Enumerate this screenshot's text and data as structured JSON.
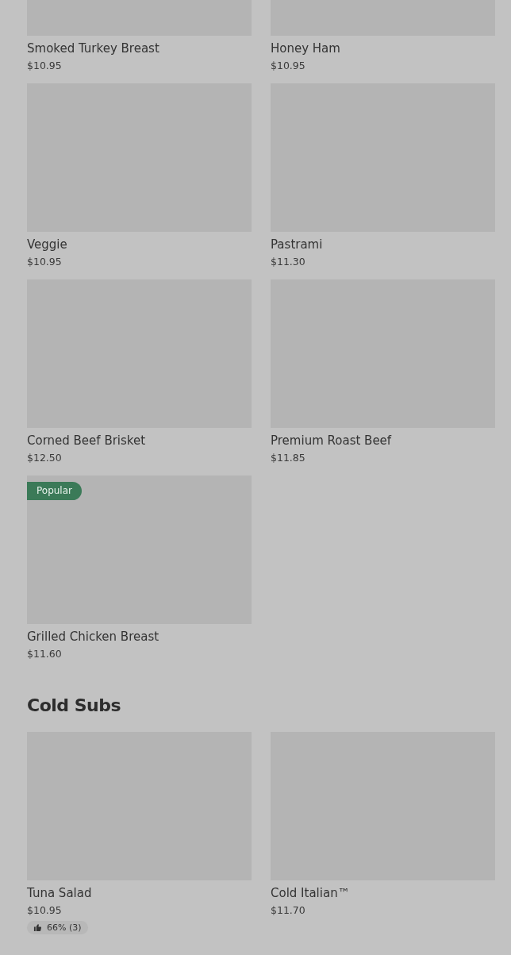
{
  "sections": [
    {
      "items": [
        {
          "name": "Smoked Turkey Breast",
          "price": "$10.95"
        },
        {
          "name": "Honey Ham",
          "price": "$10.95"
        },
        {
          "name": "Veggie",
          "price": "$10.95"
        },
        {
          "name": "Pastrami",
          "price": "$11.30"
        },
        {
          "name": "Corned Beef Brisket",
          "price": "$12.50"
        },
        {
          "name": "Premium Roast Beef",
          "price": "$11.85"
        },
        {
          "name": "Grilled Chicken Breast",
          "price": "$11.60",
          "badge": "Popular"
        }
      ]
    },
    {
      "title": "Cold Subs",
      "items": [
        {
          "name": "Tuna Salad",
          "price": "$10.95",
          "rating": "66% (3)"
        },
        {
          "name": "Cold Italian™",
          "price": "$11.70"
        }
      ]
    }
  ]
}
